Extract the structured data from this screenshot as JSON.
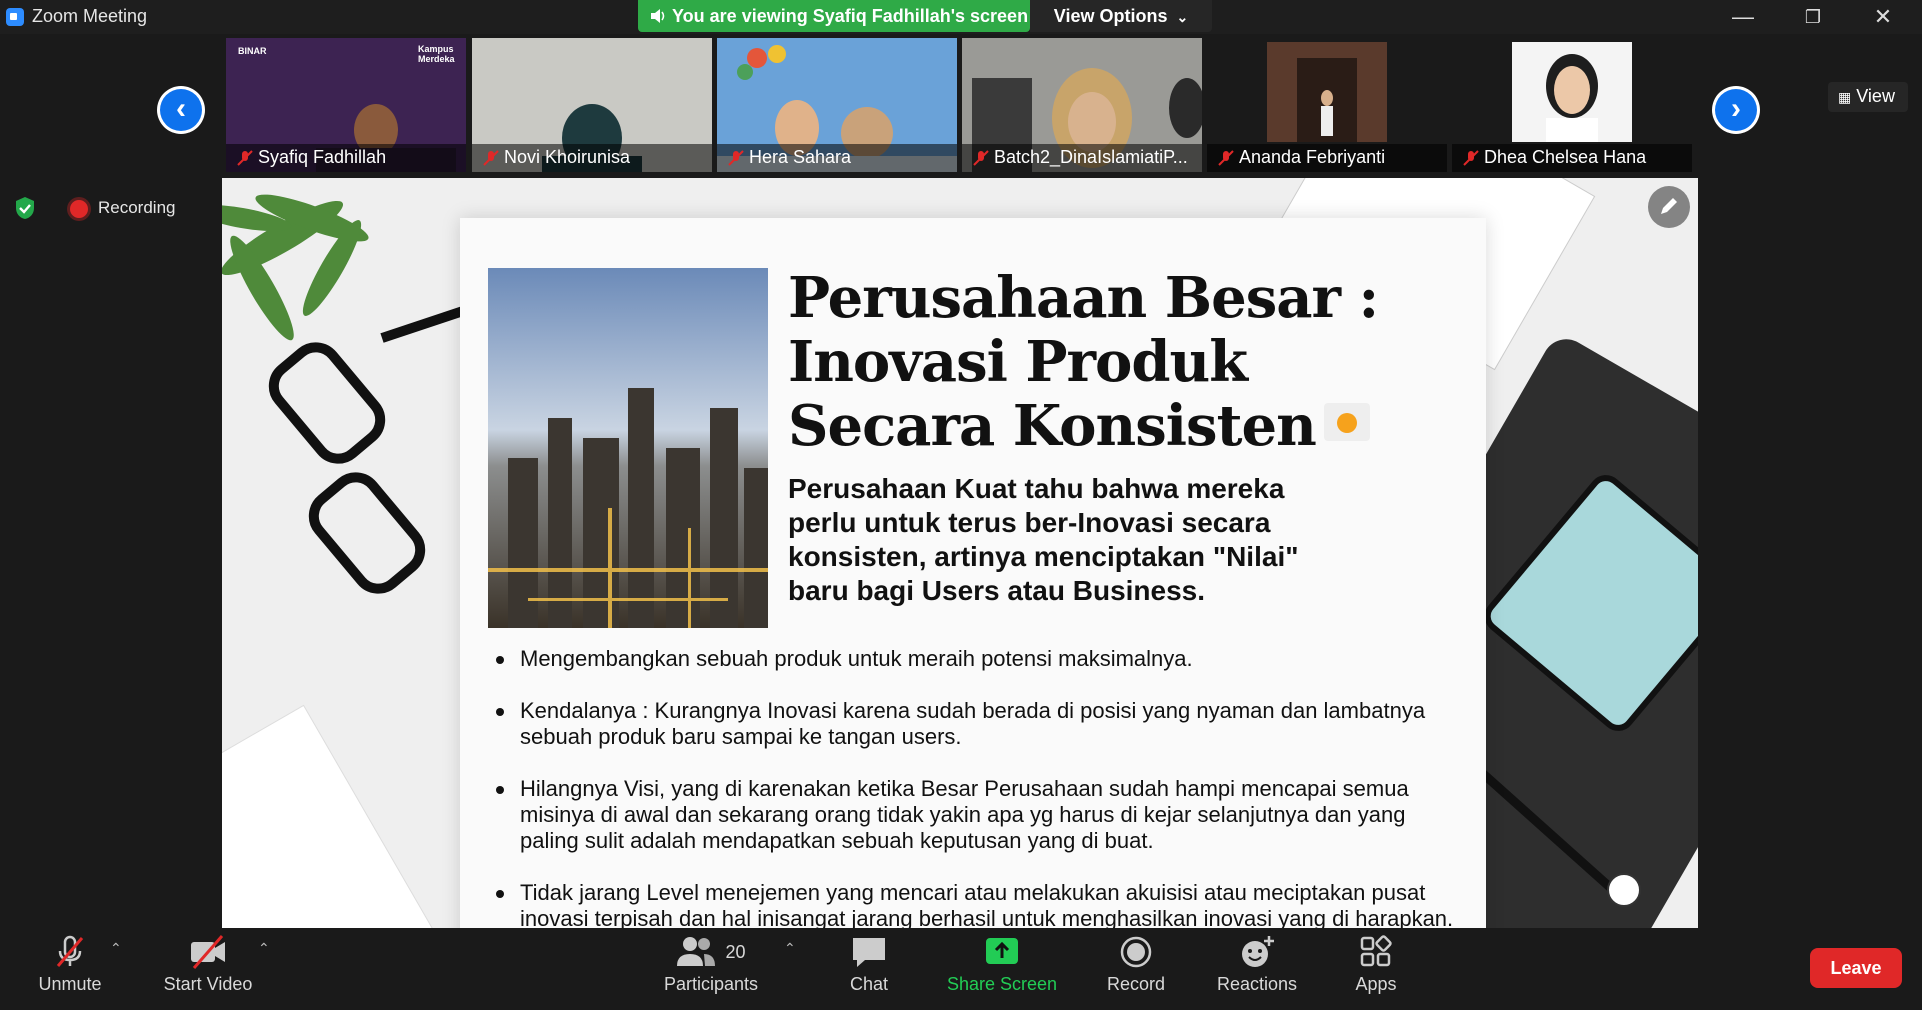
{
  "window": {
    "title": "Zoom Meeting",
    "minimize": "—",
    "restore": "❐",
    "close": "✕"
  },
  "share_banner": {
    "text": "You are viewing Syafiq Fadhillah's screen",
    "view_options": "View Options"
  },
  "gallery": {
    "view_label": "View",
    "participants": [
      {
        "name": "Syafiq Fadhillah"
      },
      {
        "name": "Novi Khoirunisa"
      },
      {
        "name": "Hera Sahara"
      },
      {
        "name": "Batch2_DinaIslamiatiP..."
      },
      {
        "name": "Ananda Febriyanti"
      },
      {
        "name": "Dhea Chelsea Hana"
      }
    ],
    "tile1_logo": "BINAR",
    "tile1_badge": "Kampus Merdeka"
  },
  "recording": {
    "label": "Recording"
  },
  "slide": {
    "title": "Perusahaan Besar : Inovasi Produk Secara Konsisten",
    "subtitle": "Perusahaan Kuat tahu bahwa mereka perlu untuk terus ber-Inovasi secara konsisten, artinya menciptakan \"Nilai\" baru bagi Users atau Business.",
    "bullets": [
      "Mengembangkan sebuah produk untuk meraih potensi maksimalnya.",
      "Kendalanya : Kurangnya Inovasi karena sudah berada di posisi yang nyaman dan lambatnya sebuah produk baru sampai ke tangan users.",
      "Hilangnya Visi, yang di karenakan ketika Besar Perusahaan sudah hampi mencapai semua misinya di awal dan sekarang orang tidak yakin apa yg harus di kejar selanjutnya dan yang paling sulit adalah mendapatkan sebuah keputusan yang di buat.",
      "Tidak jarang Level menejemen yang mencari atau melakukan akuisisi atau meciptakan pusat inovasi terpisah dan hal inisangat jarang  berhasil untuk menghasilkan inovasi yang di harapkan."
    ]
  },
  "toolbar": {
    "unmute": "Unmute",
    "start_video": "Start Video",
    "participants_count": "20",
    "participants": "Participants",
    "chat": "Chat",
    "share_screen": "Share Screen",
    "record": "Record",
    "reactions": "Reactions",
    "apps": "Apps",
    "leave": "Leave"
  }
}
